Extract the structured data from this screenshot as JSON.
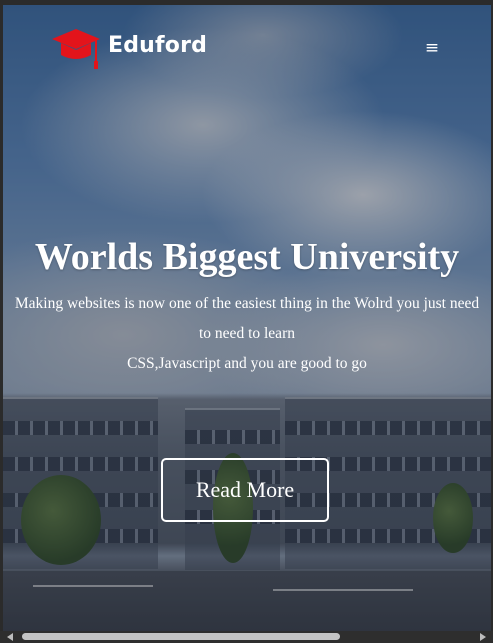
{
  "navbar": {
    "brand": "Eduford",
    "logo_icon": "graduation-cap-icon",
    "menu_icon": "menu-icon",
    "menu_glyph": "≡"
  },
  "hero": {
    "title": "Worlds Biggest University",
    "line1": "Making websites is now one of the easiest thing in the Wolrd you just need",
    "line2": "to need to learn",
    "line3": "CSS,Javascript and you are good to go",
    "button_label": "Read More"
  },
  "colors": {
    "logo": "#e3141b",
    "text": "#ffffff",
    "overlay": "#1e2634"
  }
}
